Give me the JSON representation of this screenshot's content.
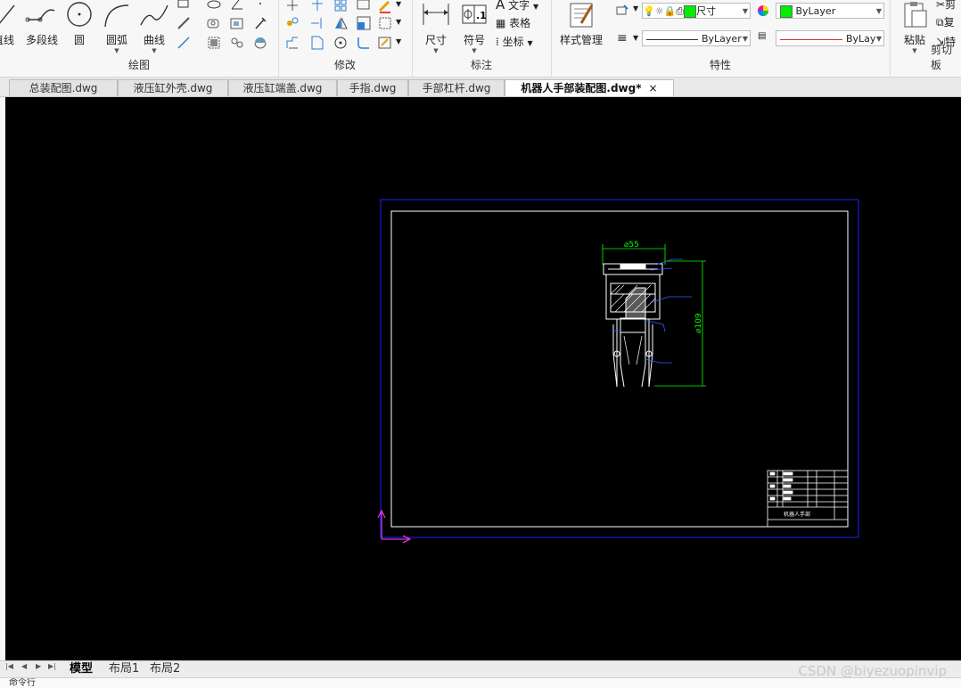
{
  "ribbon": {
    "draw": {
      "label": "绘图",
      "line_partial": "直线",
      "polyline": "多段线",
      "circle": "圆",
      "arc": "圆弧",
      "curve": "曲线"
    },
    "modify": {
      "label": "修改"
    },
    "annotation": {
      "label": "标注",
      "dimension": "尺寸",
      "symbol": "符号",
      "text": "文字",
      "table": "表格",
      "coordinate": "坐标"
    },
    "properties": {
      "label": "特性",
      "style_manager": "样式管理",
      "layer_value": "尺寸",
      "color_value": "ByLayer",
      "linetype_value": "ByLayer",
      "lineweight_value": "ByLay",
      "accent_color": "#00ee00"
    },
    "clipboard": {
      "label": "剪切板",
      "paste": "粘贴",
      "cut_partial": "剪",
      "copy_partial": "复",
      "special_partial": "特"
    }
  },
  "tabs": [
    {
      "label": "总装配图.dwg"
    },
    {
      "label": "液压缸外壳.dwg"
    },
    {
      "label": "液压缸端盖.dwg"
    },
    {
      "label": "手指.dwg"
    },
    {
      "label": "手部杠杆.dwg"
    },
    {
      "label": "机器人手部装配图.dwg*",
      "active": true
    }
  ],
  "tab_close": "×",
  "drawing": {
    "dim_top": "⌀55",
    "dim_side": "⌀109",
    "title_block_text": "机器人手部"
  },
  "layout_tabs": [
    {
      "label": "模型",
      "active": true
    },
    {
      "label": "布局1"
    },
    {
      "label": "布局2"
    }
  ],
  "watermark": "CSDN @biyezuopinvip",
  "command_line": "命令行"
}
